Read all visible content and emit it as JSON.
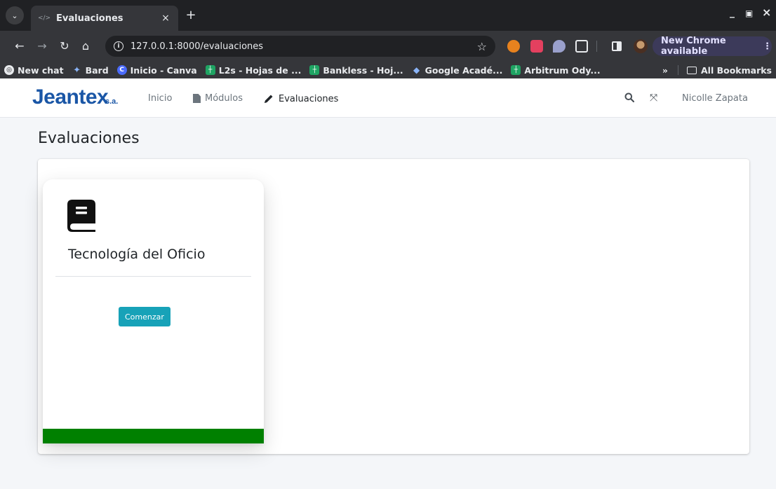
{
  "browser": {
    "tab": {
      "title": "Evaluaciones",
      "close_symbol": "×"
    },
    "new_tab_symbol": "+",
    "window_controls": {
      "minimize": "_",
      "restore": "▣",
      "close": "×"
    },
    "url": "127.0.0.1:8000/evaluaciones",
    "update_button": "New Chrome available",
    "update_menu_symbol": "⋮",
    "bookmarks": [
      {
        "label": "New chat",
        "icon": "chatgpt-icon"
      },
      {
        "label": "Bard",
        "icon": "bard-sparkle-icon"
      },
      {
        "label": "Inicio - Canva",
        "icon": "canva-icon"
      },
      {
        "label": "L2s - Hojas de ...",
        "icon": "sheets-icon"
      },
      {
        "label": "Bankless - Hoj...",
        "icon": "sheets-icon"
      },
      {
        "label": "Google Acadé...",
        "icon": "scholar-icon"
      },
      {
        "label": "Arbitrum Ody...",
        "icon": "sheets-icon"
      }
    ],
    "bookmarks_overflow": "»",
    "all_bookmarks": "All Bookmarks"
  },
  "app": {
    "brand": "Jeantex",
    "brand_suffix": "s.a.",
    "nav": [
      {
        "label": "Inicio"
      },
      {
        "label": "Módulos",
        "icon": "document-icon"
      },
      {
        "label": "Evaluaciones",
        "icon": "pencil-icon",
        "active": true
      }
    ],
    "user": "Nicolle Zapata"
  },
  "page": {
    "title": "Evaluaciones",
    "cards": [
      {
        "title": "Tecnología del Oficio",
        "button": "Comenzar",
        "icon": "book-icon",
        "footer_color": "#008000"
      }
    ]
  },
  "colors": {
    "brand": "#1a56a6",
    "button": "#17a2b8",
    "card_footer": "#008000",
    "background": "#f4f6f9"
  }
}
